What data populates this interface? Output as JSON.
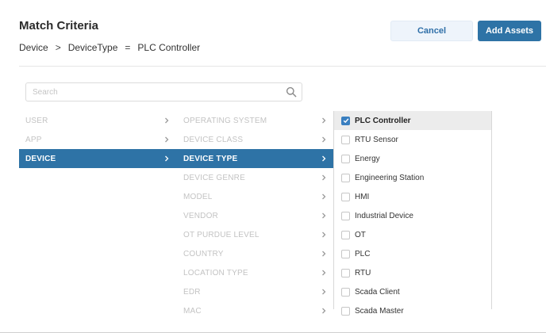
{
  "header": {
    "title": "Match Criteria",
    "breadcrumb": [
      "Device",
      "DeviceType",
      "PLC Controller"
    ],
    "breadcrumb_separators": [
      ">",
      "="
    ]
  },
  "actions": {
    "cancel_label": "Cancel",
    "add_label": "Add Assets"
  },
  "search": {
    "placeholder": "Search",
    "value": "",
    "icon": "search-icon"
  },
  "column1": {
    "items": [
      {
        "label": "USER",
        "active": false
      },
      {
        "label": "APP",
        "active": false
      },
      {
        "label": "DEVICE",
        "active": true
      }
    ]
  },
  "column2": {
    "items": [
      {
        "label": "OPERATING SYSTEM",
        "active": false
      },
      {
        "label": "DEVICE CLASS",
        "active": false
      },
      {
        "label": "DEVICE TYPE",
        "active": true
      },
      {
        "label": "DEVICE GENRE",
        "active": false
      },
      {
        "label": "MODEL",
        "active": false
      },
      {
        "label": "VENDOR",
        "active": false
      },
      {
        "label": "OT PURDUE LEVEL",
        "active": false
      },
      {
        "label": "COUNTRY",
        "active": false
      },
      {
        "label": "LOCATION TYPE",
        "active": false
      },
      {
        "label": "EDR",
        "active": false
      },
      {
        "label": "MAC",
        "active": false
      }
    ]
  },
  "column3": {
    "options": [
      {
        "label": "PLC Controller",
        "checked": true
      },
      {
        "label": "RTU Sensor",
        "checked": false
      },
      {
        "label": "Energy",
        "checked": false
      },
      {
        "label": "Engineering Station",
        "checked": false
      },
      {
        "label": "HMI",
        "checked": false
      },
      {
        "label": "Industrial Device",
        "checked": false
      },
      {
        "label": "OT",
        "checked": false
      },
      {
        "label": "PLC",
        "checked": false
      },
      {
        "label": "RTU",
        "checked": false
      },
      {
        "label": "Scada Client",
        "checked": false
      },
      {
        "label": "Scada Master",
        "checked": false
      }
    ]
  },
  "colors": {
    "accent": "#2e73a6",
    "checkbox_checked": "#3a7fc0",
    "muted_text": "#c3c3c3",
    "selected_row_bg": "#ececec"
  }
}
